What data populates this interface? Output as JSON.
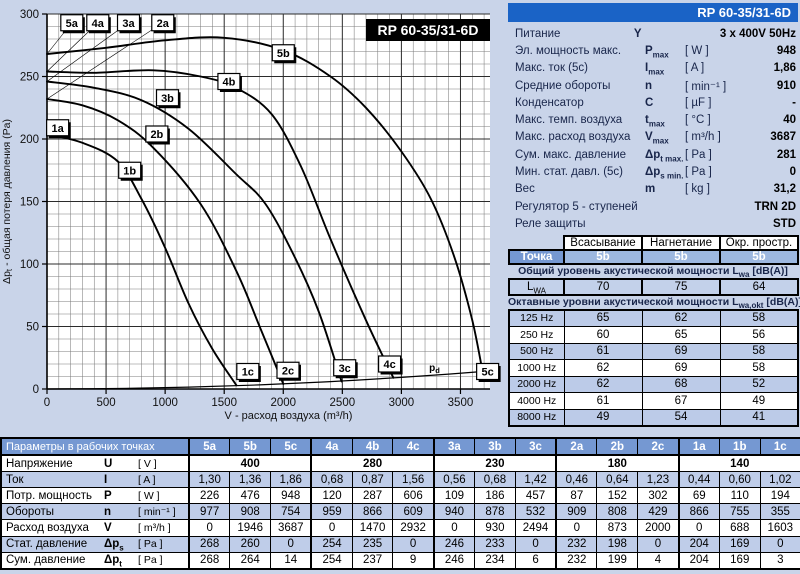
{
  "model": "RP 60-35/31-6D",
  "chart_data": {
    "type": "line",
    "title": "RP 60-35/31-6D",
    "xlabel": "V - расход воздуха (m³/h)",
    "ylabel": "Δpt - общая потеря давления (Pa)",
    "ylabel_parts": {
      "base": "Δp",
      "sub": "t",
      "rest": " - общая потеря давления (Pa)"
    },
    "xlim": [
      0,
      3750
    ],
    "ylim": [
      0,
      300
    ],
    "x_ticks": [
      0,
      500,
      1000,
      1500,
      2000,
      2500,
      3000,
      3500
    ],
    "y_ticks": [
      0,
      50,
      100,
      150,
      200,
      250,
      300
    ],
    "x_minor_step": 100,
    "y_minor_step": 10,
    "grid": "on",
    "series": [
      {
        "name": "1b",
        "points": [
          [
            0,
            204
          ],
          [
            300,
            197
          ],
          [
            600,
            182
          ],
          [
            800,
            152
          ],
          [
            1000,
            113
          ],
          [
            1200,
            68
          ],
          [
            1400,
            32
          ],
          [
            1603,
            3
          ]
        ]
      },
      {
        "name": "2b",
        "points": [
          [
            0,
            232
          ],
          [
            300,
            227
          ],
          [
            600,
            215
          ],
          [
            900,
            193
          ],
          [
            1300,
            148
          ],
          [
            1600,
            95
          ],
          [
            1800,
            50
          ],
          [
            2000,
            4
          ]
        ]
      },
      {
        "name": "3b",
        "points": [
          [
            0,
            246
          ],
          [
            400,
            241
          ],
          [
            800,
            231
          ],
          [
            1200,
            208
          ],
          [
            1600,
            172
          ],
          [
            1850,
            148
          ],
          [
            2100,
            105
          ],
          [
            2300,
            62
          ],
          [
            2494,
            6
          ]
        ]
      },
      {
        "name": "4b",
        "points": [
          [
            0,
            254
          ],
          [
            400,
            253
          ],
          [
            900,
            255
          ],
          [
            1300,
            250
          ],
          [
            1600,
            241
          ],
          [
            1900,
            220
          ],
          [
            2150,
            178
          ],
          [
            2400,
            120
          ],
          [
            2700,
            55
          ],
          [
            2932,
            9
          ]
        ]
      },
      {
        "name": "5b",
        "points": [
          [
            0,
            268
          ],
          [
            500,
            273
          ],
          [
            1000,
            279
          ],
          [
            1500,
            281
          ],
          [
            2000,
            271
          ],
          [
            2400,
            250
          ],
          [
            2700,
            225
          ],
          [
            3000,
            190
          ],
          [
            3250,
            152
          ],
          [
            3450,
            105
          ],
          [
            3600,
            55
          ],
          [
            3687,
            14
          ]
        ]
      },
      {
        "name": "pd",
        "points": [
          [
            0,
            0
          ],
          [
            600,
            0.4
          ],
          [
            1200,
            1.5
          ],
          [
            1800,
            3.3
          ],
          [
            2400,
            5.9
          ],
          [
            3000,
            9.3
          ],
          [
            3400,
            11.9
          ],
          [
            3687,
            14
          ],
          [
            3750,
            14.5
          ]
        ]
      }
    ],
    "leader_lines": [
      {
        "from": [
          0,
          268
        ],
        "to": [
          210,
          293
        ]
      },
      {
        "from": [
          0,
          254
        ],
        "to": [
          430,
          293
        ]
      },
      {
        "from": [
          0,
          246
        ],
        "to": [
          690,
          293
        ]
      },
      {
        "from": [
          0,
          232
        ],
        "to": [
          980,
          293
        ]
      }
    ],
    "point_labels": [
      {
        "text": "5a",
        "v": 210,
        "p": 293,
        "box": true
      },
      {
        "text": "4a",
        "v": 430,
        "p": 293,
        "box": true
      },
      {
        "text": "3a",
        "v": 690,
        "p": 293,
        "box": true
      },
      {
        "text": "2a",
        "v": 980,
        "p": 293,
        "box": true
      },
      {
        "text": "1a",
        "v": 90,
        "p": 209,
        "box": true
      },
      {
        "text": "1b",
        "v": 700,
        "p": 175,
        "box": true
      },
      {
        "text": "2b",
        "v": 930,
        "p": 204,
        "box": true
      },
      {
        "text": "3b",
        "v": 1020,
        "p": 233,
        "box": true
      },
      {
        "text": "4b",
        "v": 1540,
        "p": 246,
        "box": true
      },
      {
        "text": "5b",
        "v": 2000,
        "p": 269,
        "box": true
      },
      {
        "text": "1c",
        "v": 1700,
        "p": 14,
        "box": true
      },
      {
        "text": "2c",
        "v": 2040,
        "p": 15,
        "box": true
      },
      {
        "text": "3c",
        "v": 2520,
        "p": 17,
        "box": true
      },
      {
        "text": "4c",
        "v": 2900,
        "p": 20,
        "box": true
      },
      {
        "text": "5c",
        "v": 3730,
        "p": 14,
        "box": true
      },
      {
        "text": "pd",
        "v": 3280,
        "p": 17,
        "box": false,
        "subscript": true
      }
    ]
  },
  "specs": {
    "header": "RP 60-35/31-6D",
    "rows": [
      {
        "label": "Питание",
        "sym": "Y",
        "sub": "",
        "unit": "",
        "value": "3 x 400V 50Hz"
      },
      {
        "label": "Эл. мощность макс.",
        "sym": "P",
        "sub": "max",
        "unit": "[ W ]",
        "value": "948"
      },
      {
        "label": "Макс. ток  (5с)",
        "sym": "I",
        "sub": "max",
        "unit": "[ A ]",
        "value": "1,86"
      },
      {
        "label": "Средние обороты",
        "sym": "n",
        "sub": "",
        "unit": "[ min⁻¹ ]",
        "value": "910"
      },
      {
        "label": "Конденсатор",
        "sym": "C",
        "sub": "",
        "unit": "[ µF ]",
        "value": "-"
      },
      {
        "label": "Макс. темп. воздуха",
        "sym": "t",
        "sub": "max",
        "unit": "[ °C ]",
        "value": "40"
      },
      {
        "label": "Макс. расход воздуха",
        "sym": "V",
        "sub": "max",
        "unit": "[ m³/h ]",
        "value": "3687"
      },
      {
        "label": "Сум. макс. давление",
        "sym": "Δp",
        "sub": "t max.",
        "unit": "[ Pa ]",
        "value": "281"
      },
      {
        "label": "Мин. стат. давл. (5с)",
        "sym": "Δp",
        "sub": "s min.",
        "unit": "[ Pa ]",
        "value": "0"
      },
      {
        "label": "Вес",
        "sym": "m",
        "sub": "",
        "unit": "[ kg ]",
        "value": "31,2"
      },
      {
        "label": "Регулятор 5 - ступеней",
        "sym": "",
        "sub": "",
        "unit": "",
        "value": "TRN 2D"
      },
      {
        "label": "Реле защиты",
        "sym": "",
        "sub": "",
        "unit": "",
        "value": "STD"
      }
    ]
  },
  "acoustic": {
    "columns": [
      "Всасывание",
      "Нагнетание",
      "Окр. простр."
    ],
    "point_label": "Точка",
    "point_values": [
      "5b",
      "5b",
      "5b"
    ],
    "sym_base": "L",
    "total_title": "Общий уровень акустической мощности",
    "total_sub": "wa",
    "unit": "[dB(A)]",
    "lwa_sub": "WA",
    "lwa_values": [
      "70",
      "75",
      "64"
    ],
    "octave_title": "Октавные уровни акустической мощности",
    "octave_sub": "wa,okt",
    "octave_rows": [
      {
        "freq": "125 Hz",
        "values": [
          "65",
          "62",
          "58"
        ]
      },
      {
        "freq": "250 Hz",
        "values": [
          "60",
          "65",
          "56"
        ]
      },
      {
        "freq": "500 Hz",
        "values": [
          "61",
          "69",
          "58"
        ]
      },
      {
        "freq": "1000 Hz",
        "values": [
          "62",
          "69",
          "58"
        ]
      },
      {
        "freq": "2000 Hz",
        "values": [
          "62",
          "68",
          "52"
        ]
      },
      {
        "freq": "4000 Hz",
        "values": [
          "61",
          "67",
          "49"
        ]
      },
      {
        "freq": "8000 Hz",
        "values": [
          "49",
          "54",
          "41"
        ]
      }
    ]
  },
  "op_table": {
    "title": "Параметры в рабочих точках",
    "points": [
      "5a",
      "5b",
      "5c",
      "4a",
      "4b",
      "4c",
      "3a",
      "3b",
      "3c",
      "2a",
      "2b",
      "2c",
      "1a",
      "1b",
      "1c"
    ],
    "voltage_row": {
      "label": "Напряжение",
      "sym": "U",
      "sub": "",
      "unit": "[ V ]",
      "values": [
        "400",
        "280",
        "230",
        "180",
        "140"
      ]
    },
    "rows": [
      {
        "label": "Ток",
        "sym": "I",
        "sub": "",
        "unit": "[ A ]",
        "shade": "blue",
        "values": [
          "1,30",
          "1,36",
          "1,86",
          "0,68",
          "0,87",
          "1,56",
          "0,56",
          "0,68",
          "1,42",
          "0,46",
          "0,64",
          "1,23",
          "0,44",
          "0,60",
          "1,02"
        ]
      },
      {
        "label": "Потр. мощность",
        "sym": "P",
        "sub": "",
        "unit": "[ W ]",
        "shade": "white",
        "values": [
          "226",
          "476",
          "948",
          "120",
          "287",
          "606",
          "109",
          "186",
          "457",
          "87",
          "152",
          "302",
          "69",
          "110",
          "194"
        ]
      },
      {
        "label": "Обороты",
        "sym": "n",
        "sub": "",
        "unit": "[ min⁻¹ ]",
        "shade": "blue",
        "values": [
          "977",
          "908",
          "754",
          "959",
          "866",
          "609",
          "940",
          "878",
          "532",
          "909",
          "808",
          "429",
          "866",
          "755",
          "355"
        ]
      },
      {
        "label": "Расход воздуха",
        "sym": "V",
        "sub": "",
        "unit": "[ m³/h ]",
        "shade": "white",
        "values": [
          "0",
          "1946",
          "3687",
          "0",
          "1470",
          "2932",
          "0",
          "930",
          "2494",
          "0",
          "873",
          "2000",
          "0",
          "688",
          "1603"
        ]
      },
      {
        "label": "Стат. давление",
        "sym": "Δp",
        "sub": "s",
        "unit": "[ Pa ]",
        "shade": "blue",
        "values": [
          "268",
          "260",
          "0",
          "254",
          "235",
          "0",
          "246",
          "233",
          "0",
          "232",
          "198",
          "0",
          "204",
          "169",
          "0"
        ]
      },
      {
        "label": "Сум. давление",
        "sym": "Δp",
        "sub": "t",
        "unit": "[ Pa ]",
        "shade": "white",
        "values": [
          "268",
          "264",
          "14",
          "254",
          "237",
          "9",
          "246",
          "234",
          "6",
          "232",
          "199",
          "4",
          "204",
          "169",
          "3"
        ]
      }
    ]
  },
  "colors": {
    "page_bg": "#c9d4e9",
    "deep_blue": "#1a63c6",
    "mid_blue": "#7598d2",
    "point_cell_blue": "#9db8e0",
    "row_blue": "#bfcde9",
    "octave_blue": "#bccbe8",
    "curve_black": "#000000"
  }
}
